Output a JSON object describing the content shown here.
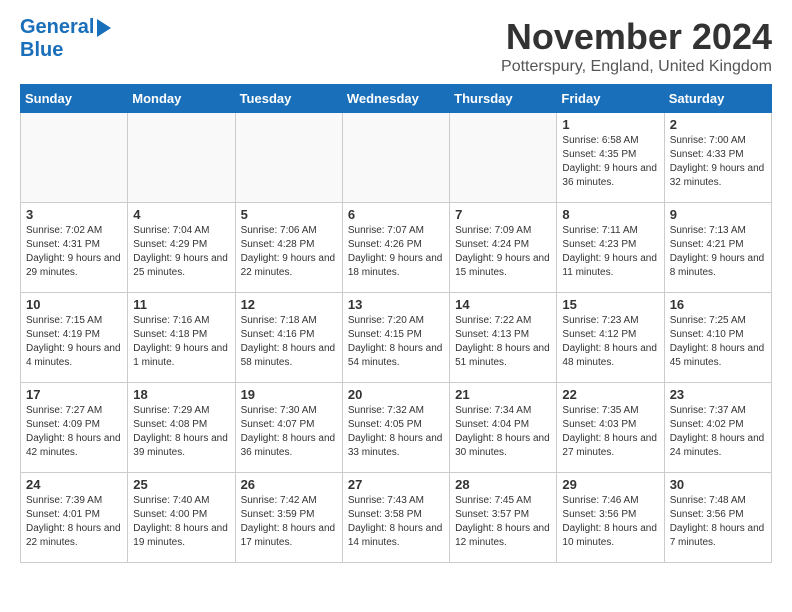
{
  "logo": {
    "line1": "General",
    "line2": "Blue"
  },
  "title": "November 2024",
  "location": "Potterspury, England, United Kingdom",
  "days_of_week": [
    "Sunday",
    "Monday",
    "Tuesday",
    "Wednesday",
    "Thursday",
    "Friday",
    "Saturday"
  ],
  "weeks": [
    [
      {
        "day": "",
        "info": ""
      },
      {
        "day": "",
        "info": ""
      },
      {
        "day": "",
        "info": ""
      },
      {
        "day": "",
        "info": ""
      },
      {
        "day": "",
        "info": ""
      },
      {
        "day": "1",
        "info": "Sunrise: 6:58 AM\nSunset: 4:35 PM\nDaylight: 9 hours and 36 minutes."
      },
      {
        "day": "2",
        "info": "Sunrise: 7:00 AM\nSunset: 4:33 PM\nDaylight: 9 hours and 32 minutes."
      }
    ],
    [
      {
        "day": "3",
        "info": "Sunrise: 7:02 AM\nSunset: 4:31 PM\nDaylight: 9 hours and 29 minutes."
      },
      {
        "day": "4",
        "info": "Sunrise: 7:04 AM\nSunset: 4:29 PM\nDaylight: 9 hours and 25 minutes."
      },
      {
        "day": "5",
        "info": "Sunrise: 7:06 AM\nSunset: 4:28 PM\nDaylight: 9 hours and 22 minutes."
      },
      {
        "day": "6",
        "info": "Sunrise: 7:07 AM\nSunset: 4:26 PM\nDaylight: 9 hours and 18 minutes."
      },
      {
        "day": "7",
        "info": "Sunrise: 7:09 AM\nSunset: 4:24 PM\nDaylight: 9 hours and 15 minutes."
      },
      {
        "day": "8",
        "info": "Sunrise: 7:11 AM\nSunset: 4:23 PM\nDaylight: 9 hours and 11 minutes."
      },
      {
        "day": "9",
        "info": "Sunrise: 7:13 AM\nSunset: 4:21 PM\nDaylight: 9 hours and 8 minutes."
      }
    ],
    [
      {
        "day": "10",
        "info": "Sunrise: 7:15 AM\nSunset: 4:19 PM\nDaylight: 9 hours and 4 minutes."
      },
      {
        "day": "11",
        "info": "Sunrise: 7:16 AM\nSunset: 4:18 PM\nDaylight: 9 hours and 1 minute."
      },
      {
        "day": "12",
        "info": "Sunrise: 7:18 AM\nSunset: 4:16 PM\nDaylight: 8 hours and 58 minutes."
      },
      {
        "day": "13",
        "info": "Sunrise: 7:20 AM\nSunset: 4:15 PM\nDaylight: 8 hours and 54 minutes."
      },
      {
        "day": "14",
        "info": "Sunrise: 7:22 AM\nSunset: 4:13 PM\nDaylight: 8 hours and 51 minutes."
      },
      {
        "day": "15",
        "info": "Sunrise: 7:23 AM\nSunset: 4:12 PM\nDaylight: 8 hours and 48 minutes."
      },
      {
        "day": "16",
        "info": "Sunrise: 7:25 AM\nSunset: 4:10 PM\nDaylight: 8 hours and 45 minutes."
      }
    ],
    [
      {
        "day": "17",
        "info": "Sunrise: 7:27 AM\nSunset: 4:09 PM\nDaylight: 8 hours and 42 minutes."
      },
      {
        "day": "18",
        "info": "Sunrise: 7:29 AM\nSunset: 4:08 PM\nDaylight: 8 hours and 39 minutes."
      },
      {
        "day": "19",
        "info": "Sunrise: 7:30 AM\nSunset: 4:07 PM\nDaylight: 8 hours and 36 minutes."
      },
      {
        "day": "20",
        "info": "Sunrise: 7:32 AM\nSunset: 4:05 PM\nDaylight: 8 hours and 33 minutes."
      },
      {
        "day": "21",
        "info": "Sunrise: 7:34 AM\nSunset: 4:04 PM\nDaylight: 8 hours and 30 minutes."
      },
      {
        "day": "22",
        "info": "Sunrise: 7:35 AM\nSunset: 4:03 PM\nDaylight: 8 hours and 27 minutes."
      },
      {
        "day": "23",
        "info": "Sunrise: 7:37 AM\nSunset: 4:02 PM\nDaylight: 8 hours and 24 minutes."
      }
    ],
    [
      {
        "day": "24",
        "info": "Sunrise: 7:39 AM\nSunset: 4:01 PM\nDaylight: 8 hours and 22 minutes."
      },
      {
        "day": "25",
        "info": "Sunrise: 7:40 AM\nSunset: 4:00 PM\nDaylight: 8 hours and 19 minutes."
      },
      {
        "day": "26",
        "info": "Sunrise: 7:42 AM\nSunset: 3:59 PM\nDaylight: 8 hours and 17 minutes."
      },
      {
        "day": "27",
        "info": "Sunrise: 7:43 AM\nSunset: 3:58 PM\nDaylight: 8 hours and 14 minutes."
      },
      {
        "day": "28",
        "info": "Sunrise: 7:45 AM\nSunset: 3:57 PM\nDaylight: 8 hours and 12 minutes."
      },
      {
        "day": "29",
        "info": "Sunrise: 7:46 AM\nSunset: 3:56 PM\nDaylight: 8 hours and 10 minutes."
      },
      {
        "day": "30",
        "info": "Sunrise: 7:48 AM\nSunset: 3:56 PM\nDaylight: 8 hours and 7 minutes."
      }
    ]
  ]
}
